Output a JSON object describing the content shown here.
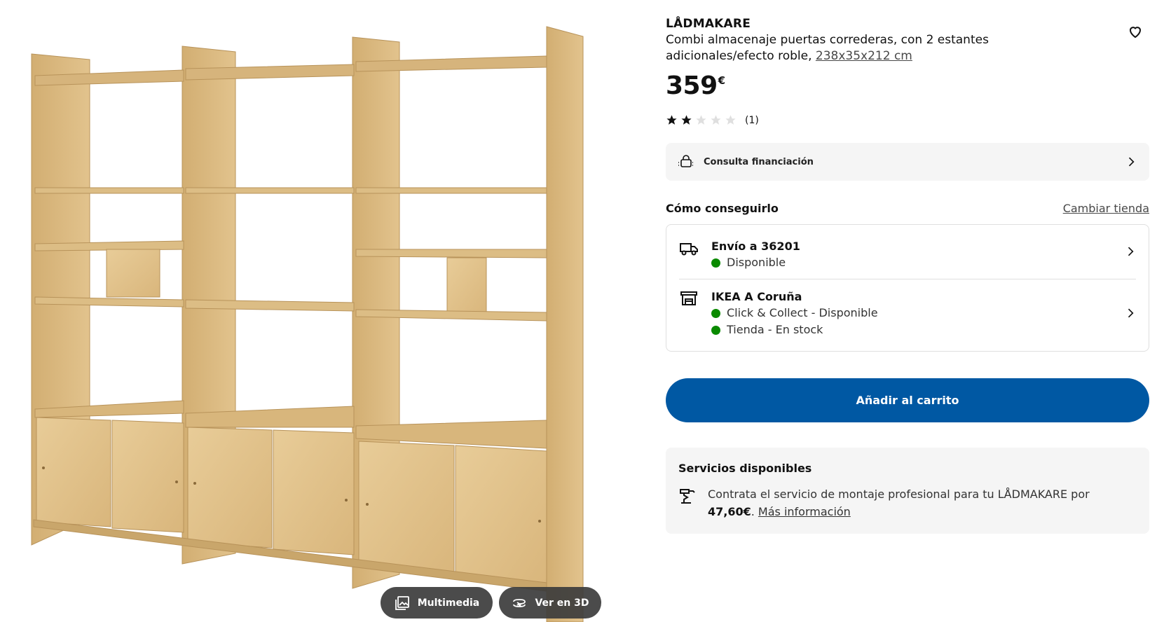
{
  "product": {
    "name": "LÅDMAKARE",
    "description": "Combi almacenaje puertas correderas, con 2 estantes adicionales/efecto roble,",
    "dimensions": "238x35x212 cm",
    "price": "359",
    "currency": "€",
    "rating": 2,
    "rating_max": 5,
    "review_count": "(1)"
  },
  "media": {
    "multimedia_label": "Multimedia",
    "view3d_label": "Ver en 3D"
  },
  "finance": {
    "label": "Consulta financiación"
  },
  "availability": {
    "title": "Cómo conseguirlo",
    "change_store": "Cambiar tienda",
    "delivery": {
      "title": "Envío a 36201",
      "status": "Disponible"
    },
    "store": {
      "title": "IKEA A Coruña",
      "status1": "Click & Collect - Disponible",
      "status2": "Tienda - En stock"
    }
  },
  "cart": {
    "label": "Añadir al carrito"
  },
  "services": {
    "title": "Servicios disponibles",
    "text_prefix": "Contrata el servicio de montaje profesional para tu LÅDMAKARE por ",
    "price": "47,60€",
    "text_suffix": ". ",
    "more": "Más información"
  },
  "colors": {
    "brand_blue": "#0058a3",
    "available_green": "#0a8a00",
    "wood_light": "#e3c48e",
    "wood_dark": "#c9a66b"
  },
  "icons": [
    "heart-icon",
    "star-icon",
    "financing-icon",
    "chevron-right-icon",
    "truck-icon",
    "store-icon",
    "assembly-icon",
    "gallery-icon",
    "rotate-3d-icon"
  ]
}
